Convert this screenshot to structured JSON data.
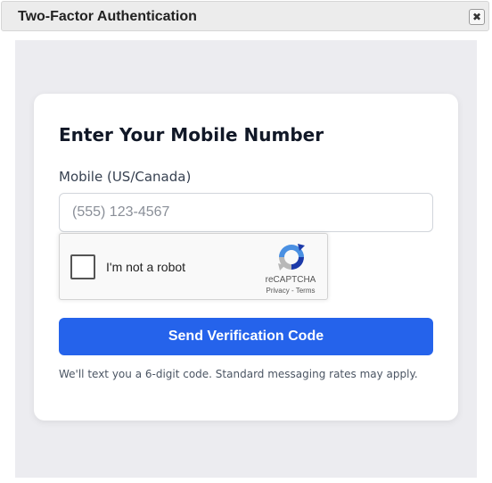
{
  "window": {
    "title": "Two-Factor Authentication",
    "close_icon": "close-icon",
    "close_glyph": "✖"
  },
  "card": {
    "title": "Enter Your Mobile Number",
    "mobile_label": "Mobile (US/Canada)",
    "mobile_value": "",
    "mobile_placeholder": "(555) 123-4567",
    "recaptcha": {
      "label": "I'm not a robot",
      "checked": false,
      "brand": "reCAPTCHA",
      "privacy": "Privacy",
      "separator": " - ",
      "terms": "Terms",
      "logo_icon": "recaptcha-logo-icon"
    },
    "send_button_label": "Send Verification Code",
    "help_text": "We'll text you a 6-digit code. Standard messaging rates may apply."
  },
  "colors": {
    "accent": "#2563eb",
    "background": "#ececf0",
    "card": "#ffffff"
  }
}
